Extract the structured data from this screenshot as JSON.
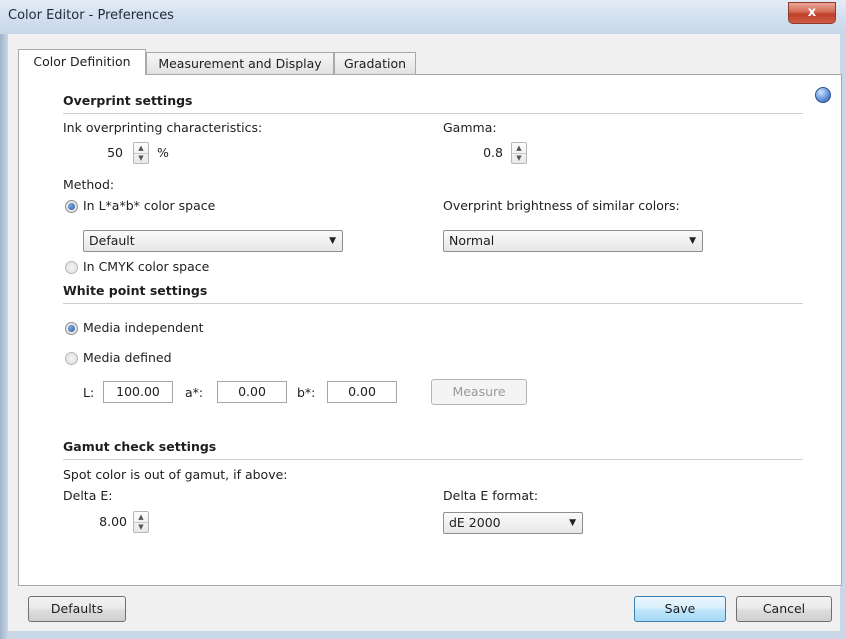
{
  "window": {
    "title": "Color Editor - Preferences",
    "close_label": "x"
  },
  "tabs": [
    {
      "label": "Color Definition"
    },
    {
      "label": "Measurement and Display"
    },
    {
      "label": "Gradation"
    }
  ],
  "overprint": {
    "heading": "Overprint settings",
    "ink_label": "Ink overprinting characteristics:",
    "ink_value": "50",
    "ink_unit": "%",
    "gamma_label": "Gamma:",
    "gamma_value": "0.8",
    "method_label": "Method:",
    "lab_label": "In L*a*b* color space",
    "lab_select": "Default",
    "cmyk_label": "In CMYK color space",
    "brightness_label": "Overprint brightness of similar colors:",
    "brightness_select": "Normal"
  },
  "whitepoint": {
    "heading": "White point settings",
    "independent_label": "Media independent",
    "defined_label": "Media defined",
    "l_label": "L:",
    "l_value": "100.00",
    "a_label": "a*:",
    "a_value": "0.00",
    "b_label": "b*:",
    "b_value": "0.00",
    "measure_label": "Measure"
  },
  "gamut": {
    "heading": "Gamut check settings",
    "note": "Spot color is out of gamut, if above:",
    "delta_label": "Delta E:",
    "delta_value": "8.00",
    "format_label": "Delta E format:",
    "format_select": "dE 2000"
  },
  "footer": {
    "defaults_label": "Defaults",
    "save_label": "Save",
    "cancel_label": "Cancel"
  }
}
